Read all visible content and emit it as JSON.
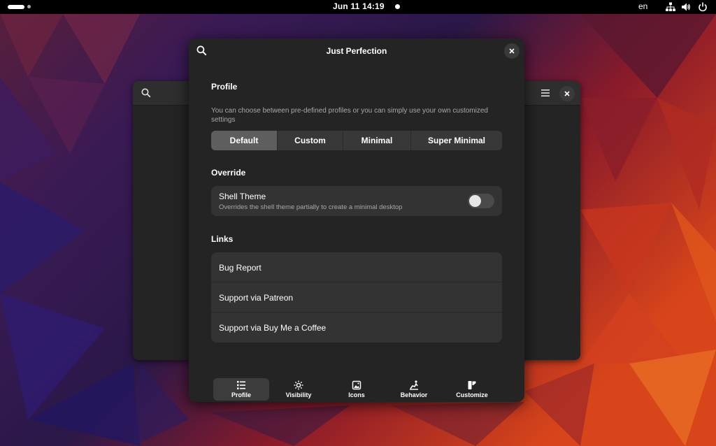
{
  "topbar": {
    "clock": "Jun 11  14:19",
    "language": "en",
    "tray_icons": [
      "network-icon",
      "volume-icon",
      "power-icon"
    ]
  },
  "dialog": {
    "title": "Just Perfection",
    "profile": {
      "title": "Profile",
      "description": "You can choose between pre-defined profiles or you can simply use your own customized settings",
      "options": [
        "Default",
        "Custom",
        "Minimal",
        "Super Minimal"
      ],
      "selected": "Default"
    },
    "override": {
      "title": "Override",
      "shell_theme": {
        "title": "Shell Theme",
        "subtitle": "Overrides the shell theme partially to create a minimal desktop",
        "enabled": false
      }
    },
    "links": {
      "title": "Links",
      "items": [
        "Bug Report",
        "Support via Patreon",
        "Support via Buy Me a Coffee"
      ]
    },
    "nav": {
      "items": [
        {
          "label": "Profile",
          "icon": "list-icon"
        },
        {
          "label": "Visibility",
          "icon": "sun-icon"
        },
        {
          "label": "Icons",
          "icon": "image-icon"
        },
        {
          "label": "Behavior",
          "icon": "runner-icon"
        },
        {
          "label": "Customize",
          "icon": "brush-icon"
        }
      ],
      "active": "Profile"
    }
  },
  "colors": {
    "dialog_bg": "#242424",
    "card_bg": "#333333",
    "accent_active": "#5e5e5e"
  }
}
